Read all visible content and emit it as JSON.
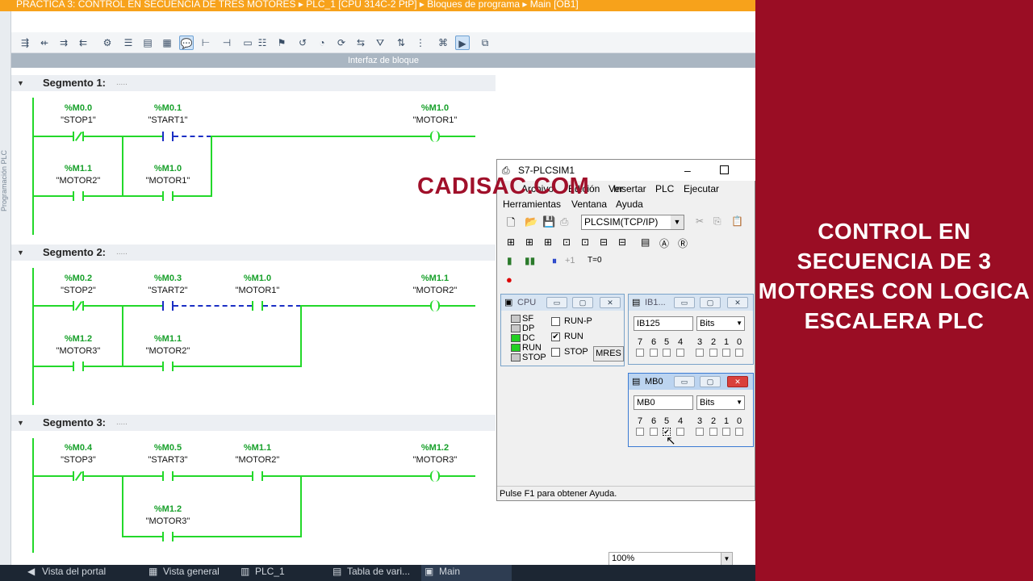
{
  "breadcrumb": "PRACTICA 3: CONTROL EN SECUENCIA DE TRES MOTORES  ▸  PLC_1 [CPU 314C-2 PtP]  ▸  Bloques de programa  ▸  Main [OB1]",
  "side_label": "Programación PLC",
  "interface_bar": "Interfaz de bloque",
  "segments": [
    {
      "label": "Segmento 1:",
      "dots": "....."
    },
    {
      "label": "Segmento 2:",
      "dots": "....."
    },
    {
      "label": "Segmento 3:",
      "dots": "....."
    }
  ],
  "contacts": {
    "s1_stop1": {
      "addr": "%M0.0",
      "sym": "\"STOP1\""
    },
    "s1_start1": {
      "addr": "%M0.1",
      "sym": "\"START1\""
    },
    "s1_motor2": {
      "addr": "%M1.1",
      "sym": "\"MOTOR2\""
    },
    "s1_motor1b": {
      "addr": "%M1.0",
      "sym": "\"MOTOR1\""
    },
    "s1_coil": {
      "addr": "%M1.0",
      "sym": "\"MOTOR1\""
    },
    "s2_stop2": {
      "addr": "%M0.2",
      "sym": "\"STOP2\""
    },
    "s2_start2": {
      "addr": "%M0.3",
      "sym": "\"START2\""
    },
    "s2_motor1": {
      "addr": "%M1.0",
      "sym": "\"MOTOR1\""
    },
    "s2_motor3": {
      "addr": "%M1.2",
      "sym": "\"MOTOR3\""
    },
    "s2_motor2b": {
      "addr": "%M1.1",
      "sym": "\"MOTOR2\""
    },
    "s2_coil": {
      "addr": "%M1.1",
      "sym": "\"MOTOR2\""
    },
    "s3_stop3": {
      "addr": "%M0.4",
      "sym": "\"STOP3\""
    },
    "s3_start3": {
      "addr": "%M0.5",
      "sym": "\"START3\""
    },
    "s3_motor2": {
      "addr": "%M1.1",
      "sym": "\"MOTOR2\""
    },
    "s3_motor3b": {
      "addr": "%M1.2",
      "sym": "\"MOTOR3\""
    },
    "s3_coil": {
      "addr": "%M1.2",
      "sym": "\"MOTOR3\""
    }
  },
  "watermark": "CADISAC.COM",
  "plcsim": {
    "title": "S7-PLCSIM1",
    "menu": [
      "Archivo",
      "Edición",
      "Ver",
      "Insertar",
      "PLC",
      "Ejecutar",
      "Herramientas",
      "Ventana",
      "Ayuda"
    ],
    "connection": "PLCSIM(TCP/IP)",
    "step_label": "+1",
    "t0_label": "T=0",
    "status": "Pulse F1 para obtener Ayuda.",
    "cpu": {
      "title": "CPU",
      "leds": [
        {
          "label": "SF",
          "color": "#c8c8c8"
        },
        {
          "label": "DP",
          "color": "#c8c8c8"
        },
        {
          "label": "DC",
          "color": "#22d022"
        },
        {
          "label": "RUN",
          "color": "#22d022"
        },
        {
          "label": "STOP",
          "color": "#c8c8c8"
        }
      ],
      "modes": [
        {
          "label": "RUN-P",
          "checked": false
        },
        {
          "label": "RUN",
          "checked": true
        },
        {
          "label": "STOP",
          "checked": false
        }
      ],
      "mres": "MRES"
    },
    "ib1": {
      "title": "IB1...",
      "field": "IB125",
      "format": "Bits",
      "bits": [
        "7",
        "6",
        "5",
        "4",
        "3",
        "2",
        "1",
        "0"
      ]
    },
    "mb0": {
      "title": "MB0",
      "field": "MB0",
      "format": "Bits",
      "bits": [
        "7",
        "6",
        "5",
        "4",
        "3",
        "2",
        "1",
        "0"
      ],
      "checked_bit": "5"
    }
  },
  "red_panel": {
    "title": "CONTROL EN SECUENCIA DE 3 MOTORES CON LOGICA ESCALERA PLC"
  },
  "taskbar": [
    "Vista del portal",
    "Vista general",
    "PLC_1",
    "Tabla de vari...",
    "Main"
  ],
  "zoom": "100%"
}
